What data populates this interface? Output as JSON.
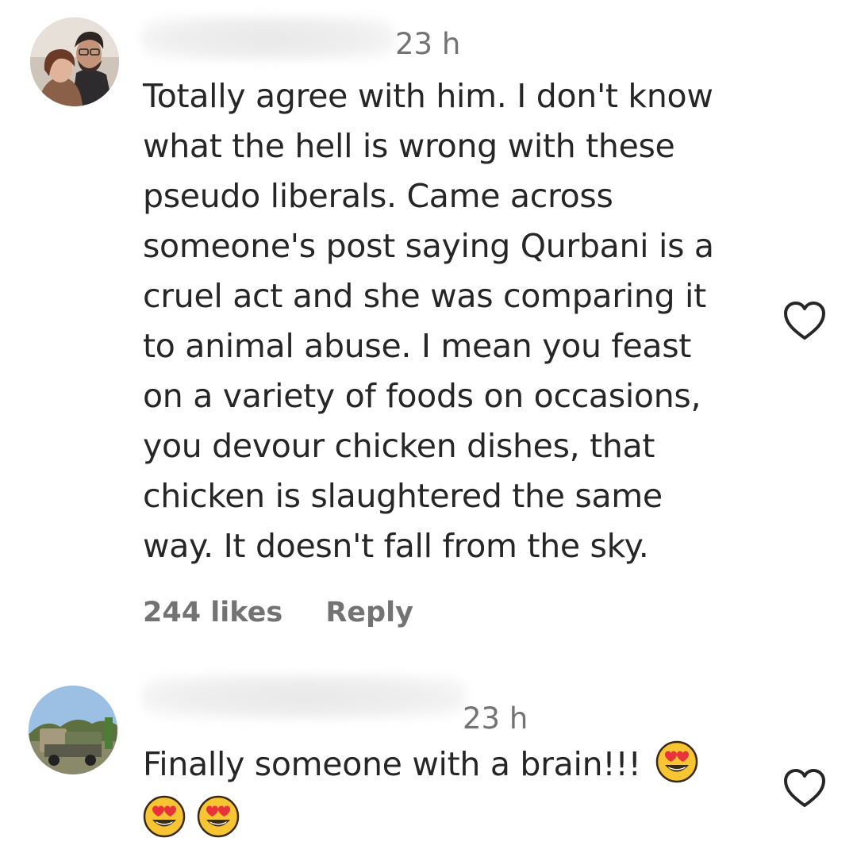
{
  "comments": [
    {
      "timestamp": "23 h",
      "lines": [
        "Totally agree with him. I don't know",
        "what the hell is wrong with these",
        "pseudo liberals. Came across",
        "someone's post saying Qurbani is a",
        "cruel act and she was comparing it",
        "to animal abuse. I mean you feast",
        "on a variety of foods on occasions,",
        "you devour chicken dishes, that",
        "chicken is slaughtered the same",
        "way. It doesn't fall from the sky."
      ],
      "likes": "244 likes",
      "reply_label": "Reply",
      "like_icon": "heart-outline-icon"
    },
    {
      "timestamp": "23 h",
      "text": "Finally someone with a brain!!!",
      "emojis": [
        "heart-eyes-emoji",
        "heart-eyes-emoji",
        "heart-eyes-emoji"
      ],
      "like_icon": "heart-outline-icon"
    }
  ],
  "colors": {
    "text_primary": "#262626",
    "text_secondary": "#737373",
    "emoji_face": "#f7c531",
    "emoji_heart": "#e8333a"
  }
}
